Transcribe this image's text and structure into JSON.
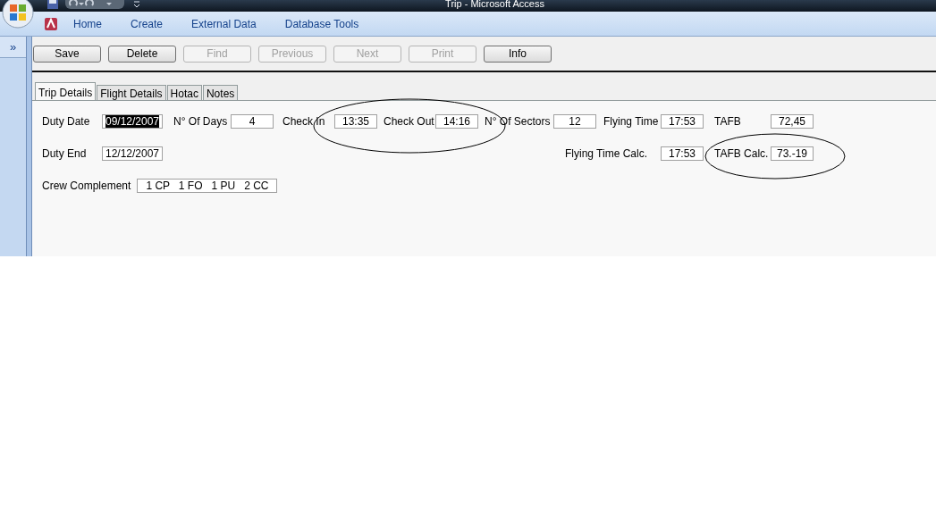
{
  "window": {
    "title": "Trip - Microsoft Access"
  },
  "ribbon_tabs": [
    {
      "label": "Home"
    },
    {
      "label": "Create"
    },
    {
      "label": "External Data"
    },
    {
      "label": "Database Tools"
    }
  ],
  "nav_pane": {
    "toggle": "»"
  },
  "toolbar": [
    {
      "label": "Save",
      "disabled": false
    },
    {
      "label": "Delete",
      "disabled": false
    },
    {
      "label": "Find",
      "disabled": true
    },
    {
      "label": "Previous",
      "disabled": true
    },
    {
      "label": "Next",
      "disabled": true
    },
    {
      "label": "Print",
      "disabled": true
    },
    {
      "label": "Info",
      "disabled": false
    }
  ],
  "form_tabs": [
    {
      "label": "Trip Details",
      "selected": true
    },
    {
      "label": "Flight Details",
      "selected": false
    },
    {
      "label": "Hotac",
      "selected": false
    },
    {
      "label": "Notes",
      "selected": false
    }
  ],
  "fields": [
    {
      "label": "Duty Date",
      "value": "09/12/2007",
      "highlighted": true
    },
    {
      "label": "N° Of Days",
      "value": "4",
      "highlighted": false
    },
    {
      "label": "Check In",
      "value": "13:35",
      "highlighted": false
    },
    {
      "label": "Check Out",
      "value": "14:16",
      "highlighted": false
    },
    {
      "label": "N° Of Sectors",
      "value": "12",
      "highlighted": false
    },
    {
      "label": "Flying Time",
      "value": "17:53",
      "highlighted": false
    },
    {
      "label": "TAFB",
      "value": "72,45",
      "highlighted": false
    },
    {
      "label": "Duty End",
      "value": "12/12/2007",
      "highlighted": false
    },
    {
      "label": "Flying Time Calc.",
      "value": "17:53",
      "highlighted": false
    },
    {
      "label": "TAFB Calc.",
      "value": "73.-19",
      "highlighted": false
    },
    {
      "label": "Crew Complement",
      "value": "1 CP   1 FO   1 PU   2 CC",
      "highlighted": false
    }
  ]
}
